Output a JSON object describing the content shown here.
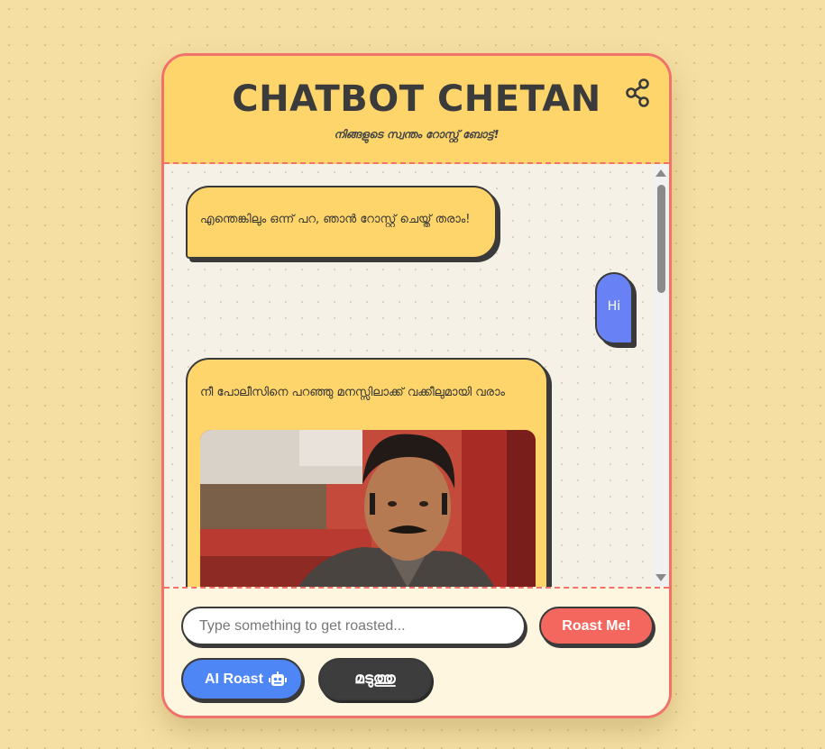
{
  "header": {
    "title": "Chatbot Chetan",
    "subtitle": "നിങ്ങളുടെ സ്വന്തം റോസ്റ്റ് ബോട്ട്!"
  },
  "messages": [
    {
      "sender": "bot",
      "text": "എന്തെങ്കിലും ഒന്ന് പറ, ഞാൻ റോസ്റ്റ് ചെയ്ത് തരാം!"
    },
    {
      "sender": "user",
      "text": "Hi"
    },
    {
      "sender": "bot",
      "text": "നീ പോലീസിനെ പറഞ്ഞു മനസ്സിലാക്ക് വക്കീലുമായി വരാം",
      "has_image": true
    }
  ],
  "input": {
    "placeholder": "Type something to get roasted...",
    "value": ""
  },
  "buttons": {
    "roast": "Roast Me!",
    "ai_roast": "AI Roast",
    "bored": "മടുത്തു"
  },
  "icons": {
    "share": "share-icon",
    "robot": "robot-icon"
  },
  "colors": {
    "accent": "#f0726a",
    "header_bg": "#fdd56b",
    "user_bubble": "#6882f5",
    "roast_button": "#f4675e",
    "ai_button": "#4e86f5",
    "bored_button": "#3d3d3d"
  }
}
